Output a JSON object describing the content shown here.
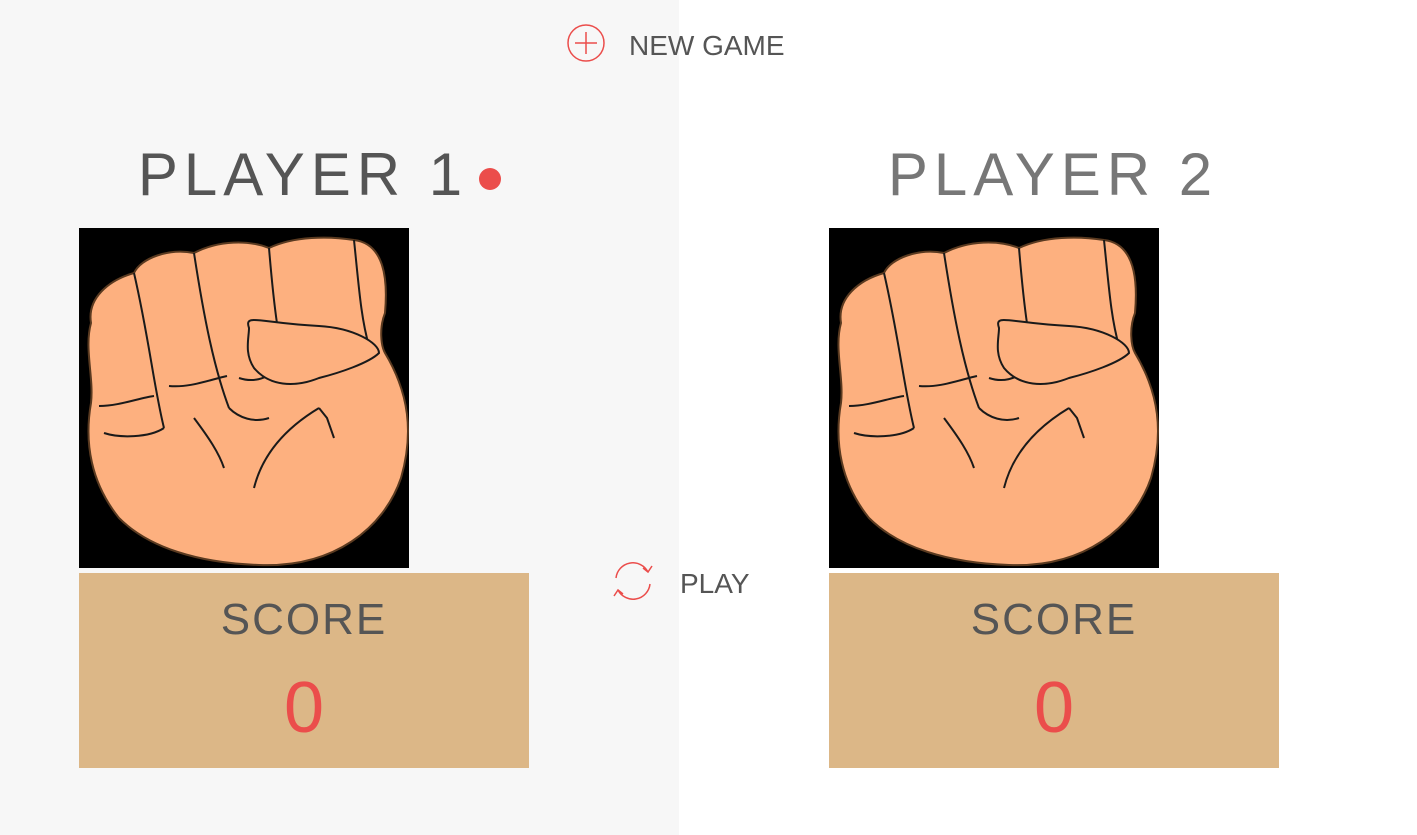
{
  "buttons": {
    "new_game": {
      "label": "NEW GAME",
      "icon": "plus-circle-icon"
    },
    "play": {
      "label": "PLAY",
      "icon": "refresh-icon"
    }
  },
  "players": [
    {
      "name": "PLAYER 1",
      "active": true,
      "score_label": "SCORE",
      "score": "0",
      "hand": "fist-icon"
    },
    {
      "name": "PLAYER 2",
      "active": false,
      "score_label": "SCORE",
      "score": "0",
      "hand": "fist-icon"
    }
  ],
  "colors": {
    "accent": "#eb4d4b",
    "score_box": "#dcb787",
    "left_bg": "#f7f7f7",
    "right_bg": "#ffffff",
    "skin": "#fdb07f"
  }
}
